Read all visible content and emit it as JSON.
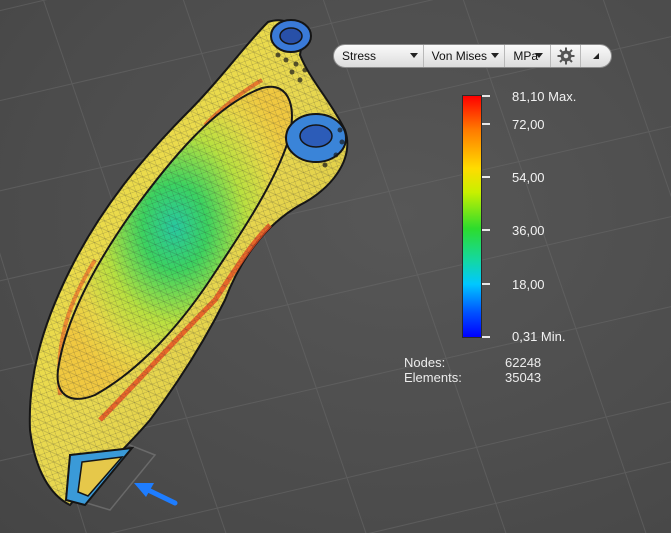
{
  "toolbar": {
    "result_type": "Stress",
    "component": "Von Mises",
    "unit": "MPa"
  },
  "legend": {
    "labels": [
      "81,10 Max.",
      "72,00",
      "54,00",
      "36,00",
      "18,00",
      "0,31 Min."
    ],
    "colors": [
      "#ff0000",
      "#ff7a00",
      "#ffdc00",
      "#2ddc2d",
      "#00c8ff",
      "#0000ff"
    ]
  },
  "stats": {
    "nodes_label": "Nodes:",
    "nodes_value": "62248",
    "elements_label": "Elements:",
    "elements_value": "35043"
  },
  "icons": [
    "gear-icon",
    "expand-triangle-icon",
    "load-arrow-icon"
  ]
}
